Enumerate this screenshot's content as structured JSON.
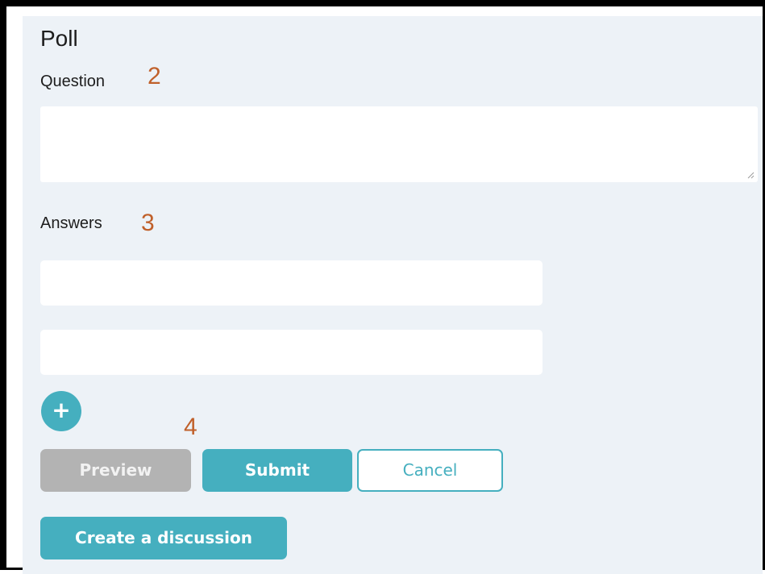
{
  "poll": {
    "title": "Poll",
    "question_label": "Question",
    "question_value": "",
    "answers_label": "Answers",
    "answers": [
      {
        "value": "",
        "placeholder": ""
      },
      {
        "value": "",
        "placeholder": ""
      }
    ],
    "add_answer_symbol": "+"
  },
  "annotations": {
    "question_marker": "2",
    "answers_marker": "3",
    "buttons_marker": "4"
  },
  "buttons": {
    "preview_label": "Preview",
    "submit_label": "Submit",
    "cancel_label": "Cancel",
    "create_discussion_label": "Create a discussion"
  },
  "colors": {
    "accent": "#45afbf",
    "disabled": "#b3b3b3",
    "panel_background": "#edf2f7",
    "annotation": "#c0602a"
  }
}
